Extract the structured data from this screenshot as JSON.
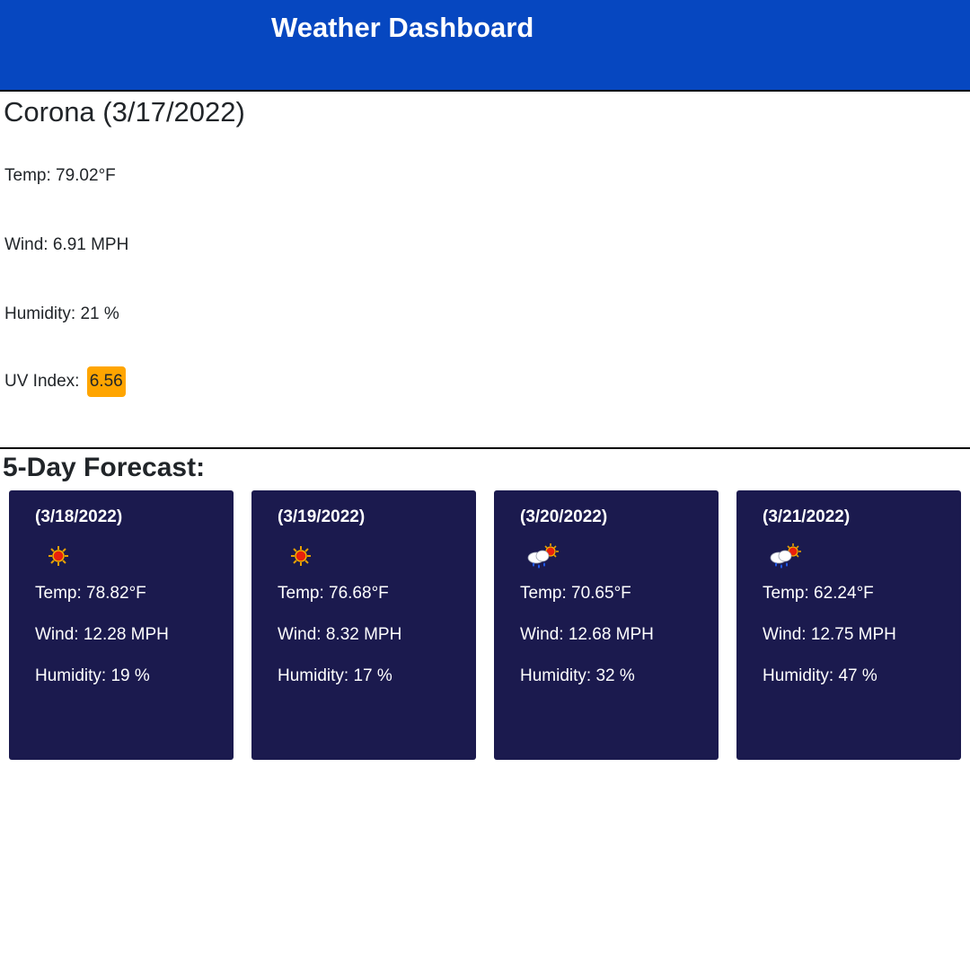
{
  "header": {
    "title": "Weather Dashboard"
  },
  "current": {
    "city": "Corona",
    "date": "(3/17/2022)",
    "title": "Corona (3/17/2022)",
    "temp": "Temp: 79.02°F",
    "wind": "Wind: 6.91 MPH",
    "humidity": "Humidity: 21 %",
    "uv_label": "UV Index:",
    "uv_value": "6.56",
    "uv_color": "#ffa500"
  },
  "forecast": {
    "title": "5-Day Forecast:",
    "days": [
      {
        "date": "(3/18/2022)",
        "icon": "sun-icon",
        "temp": "Temp: 78.82°F",
        "wind": "Wind: 12.28 MPH",
        "humidity": "Humidity: 19 %"
      },
      {
        "date": "(3/19/2022)",
        "icon": "sun-icon",
        "temp": "Temp: 76.68°F",
        "wind": "Wind: 8.32 MPH",
        "humidity": "Humidity: 17 %"
      },
      {
        "date": "(3/20/2022)",
        "icon": "sun-rain-cloud-icon",
        "temp": "Temp: 70.65°F",
        "wind": "Wind: 12.68 MPH",
        "humidity": "Humidity: 32 %"
      },
      {
        "date": "(3/21/2022)",
        "icon": "sun-rain-cloud-icon",
        "temp": "Temp: 62.24°F",
        "wind": "Wind: 12.75 MPH",
        "humidity": "Humidity: 47 %"
      }
    ]
  },
  "colors": {
    "header_bg": "#0647c0",
    "card_bg": "#1b1a4e",
    "uv_badge": "#ffa500"
  }
}
